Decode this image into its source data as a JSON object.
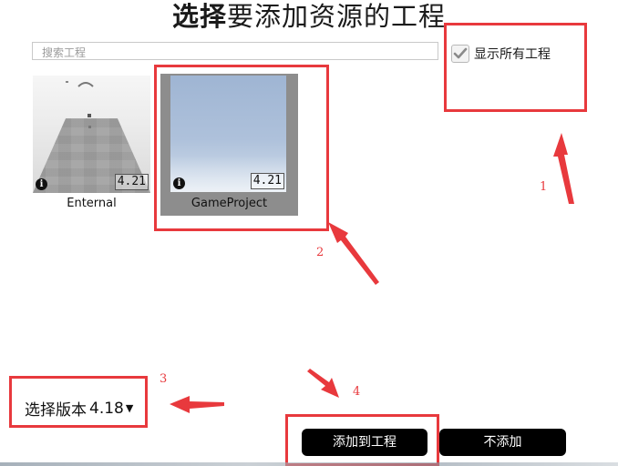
{
  "dialog": {
    "title_bold": "选择",
    "title_rest": "要添加资源的工程"
  },
  "search": {
    "placeholder": "搜索工程"
  },
  "show_all": {
    "label": "显示所有工程",
    "checked": true
  },
  "projects": [
    {
      "name": "Enternal",
      "version": "4.21",
      "selected": false
    },
    {
      "name": "GameProject",
      "version": "4.21",
      "selected": true
    }
  ],
  "version_select": {
    "label_prefix": "选择版本",
    "value": "4.18"
  },
  "buttons": {
    "add": "添加到工程",
    "cancel": "不添加"
  },
  "annotations": {
    "n1": "1",
    "n2": "2",
    "n3": "3",
    "n4": "4",
    "color": "#e8393d"
  },
  "icons": {
    "check": "check-icon",
    "info": "info-icon",
    "dropdown": "caret-down-icon"
  }
}
